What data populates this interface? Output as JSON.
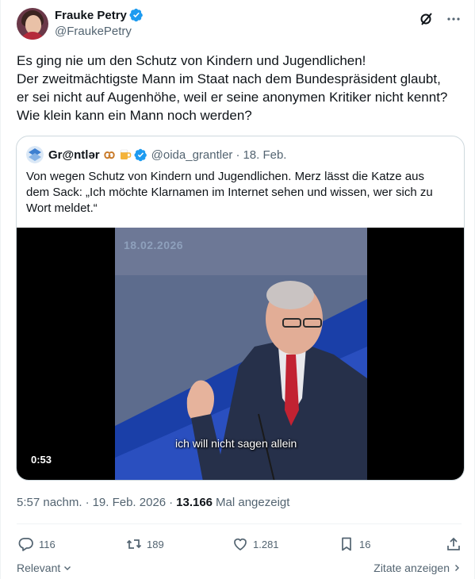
{
  "author": {
    "display_name": "Frauke Petry",
    "handle": "@FraukePetry"
  },
  "post": {
    "lines": [
      "Es ging nie um den Schutz von Kindern und Jugendlichen!",
      "Der zweitmächtigste Mann im Staat nach dem Bundespräsident glaubt,",
      "er sei nicht auf Augenhöhe, weil er seine anonymen Kritiker nicht kennt?",
      "Wie klein kann ein Mann noch werden?"
    ]
  },
  "quoted": {
    "display_name": "Gr@ntlər",
    "emojis": [
      "pretzel-emoji",
      "beer-emoji"
    ],
    "handle": "@oida_grantler",
    "separator": "·",
    "date": "18. Feb.",
    "lines": [
      "Von wegen Schutz von Kindern und Jugendlichen. Merz lässt die Katze aus",
      "dem Sack: „Ich möchte Klarnamen im Internet sehen und wissen, wer sich zu",
      "Wort meldet.“"
    ],
    "video": {
      "date_stamp": "18.02.2026",
      "subtitle": "ich will nicht sagen allein",
      "duration": "0:53"
    }
  },
  "meta": {
    "time": "5:57 nachm.",
    "separator": "·",
    "date": "19. Feb. 2026",
    "views_count": "13.166",
    "views_label": "Mal angezeigt"
  },
  "actions": {
    "replies": "116",
    "reposts": "189",
    "likes": "1.281",
    "bookmarks": "16"
  },
  "footer": {
    "relevant": "Relevant",
    "quotes": "Zitate anzeigen"
  },
  "icons": {
    "verified": "verified-badge-icon",
    "grok": "grok-icon",
    "more": "more-icon",
    "reply": "reply-icon",
    "repost": "repost-icon",
    "like": "heart-icon",
    "bookmark": "bookmark-icon",
    "share": "share-icon"
  },
  "colors": {
    "verified": "#1d9bf0",
    "text": "#0f1419",
    "secondary": "#536471",
    "border": "#cfd9de"
  }
}
